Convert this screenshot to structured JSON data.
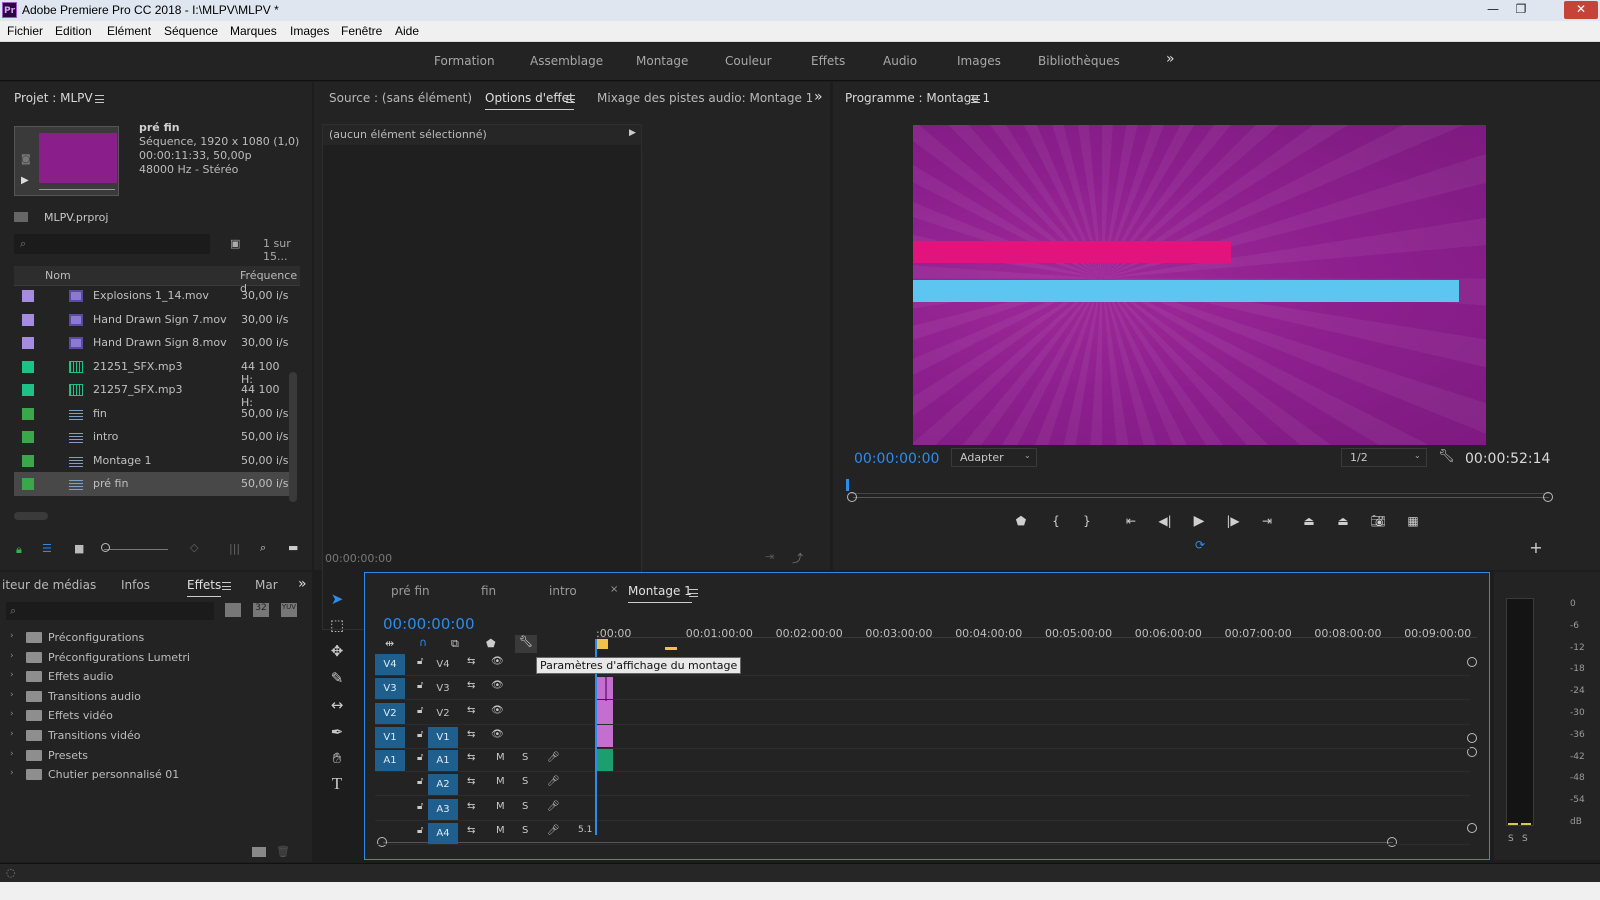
{
  "window": {
    "title": "Adobe Premiere Pro CC 2018 - I:\\MLPV\\MLPV *",
    "app_badge": "Pr"
  },
  "menu": [
    "Fichier",
    "Edition",
    "Elément",
    "Séquence",
    "Marques",
    "Images",
    "Fenêtre",
    "Aide"
  ],
  "workspaces": [
    "Formation",
    "Assemblage",
    "Montage",
    "Couleur",
    "Effets",
    "Audio",
    "Images",
    "Bibliothèques"
  ],
  "project": {
    "tab": "Projet : MLPV",
    "clip_name": "pré fin",
    "clip_info1": "Séquence, 1920 x 1080 (1,0)",
    "clip_info2": "00:00:11:33, 50,00p",
    "clip_info3": "48000 Hz - Stéréo",
    "file": "MLPV.prproj",
    "count": "1 sur 15...",
    "col_name": "Nom",
    "col_rate": "Fréquence d",
    "items": [
      {
        "name": "Explosions 1_14.mov",
        "rate": "30,00 i/s",
        "color": "#a78be0",
        "type": "video"
      },
      {
        "name": "Hand Drawn Sign 7.mov",
        "rate": "30,00 i/s",
        "color": "#a78be0",
        "type": "video"
      },
      {
        "name": "Hand Drawn Sign 8.mov",
        "rate": "30,00 i/s",
        "color": "#a78be0",
        "type": "video"
      },
      {
        "name": "21251_SFX.mp3",
        "rate": "44 100  H:",
        "color": "#1fc286",
        "type": "audio"
      },
      {
        "name": "21257_SFX.mp3",
        "rate": "44 100  H:",
        "color": "#1fc286",
        "type": "audio"
      },
      {
        "name": "fin",
        "rate": "50,00 i/s",
        "color": "#3aa84a",
        "type": "sequence"
      },
      {
        "name": "intro",
        "rate": "50,00 i/s",
        "color": "#3aa84a",
        "type": "sequence"
      },
      {
        "name": "Montage 1",
        "rate": "50,00 i/s",
        "color": "#3aa84a",
        "type": "sequence"
      },
      {
        "name": "pré fin",
        "rate": "50,00 i/s",
        "color": "#3aa84a",
        "type": "sequence"
      }
    ]
  },
  "source_panel": {
    "tabs": [
      "Source : (sans élément)",
      "Options d'effet",
      "Mixage des pistes audio: Montage 1"
    ],
    "active": "Options d'effet",
    "empty_label": "(aucun élément sélectionné)",
    "timecode": "00:00:00:00"
  },
  "program": {
    "tab": "Programme : Montage 1",
    "timecode": "00:00:00:00",
    "fit": "Adapter",
    "resolution": "1/2",
    "duration": "00:00:52:14",
    "colors": {
      "bg": "#8c1f8d",
      "pink": "#e3137e",
      "blue": "#5cc5f0",
      "accent": "#2d8ceb"
    }
  },
  "effects_panel": {
    "tabs": [
      "iteur de médias",
      "Infos",
      "Effets",
      "Mar"
    ],
    "active": "Effets",
    "tree": [
      "Préconfigurations",
      "Préconfigurations Lumetri",
      "Effets audio",
      "Transitions audio",
      "Effets vidéo",
      "Transitions vidéo",
      "Presets",
      "Chutier personnalisé 01"
    ]
  },
  "timeline": {
    "tabs": [
      "pré fin",
      "fin",
      "intro",
      "Montage 1"
    ],
    "active": "Montage 1",
    "timecode": "00:00:00:00",
    "tooltip": "Paramètres d'affichage du montage",
    "ruler": [
      ":00:00",
      "00:01:00:00",
      "00:02:00:00",
      "00:03:00:00",
      "00:04:00:00",
      "00:05:00:00",
      "00:06:00:00",
      "00:07:00:00",
      "00:08:00:00",
      "00:09:00:00"
    ],
    "video_tracks": [
      {
        "target": "V4",
        "name": "V4"
      },
      {
        "target": "V3",
        "name": "V3"
      },
      {
        "target": "V2",
        "name": "V2"
      },
      {
        "target": "V1",
        "name": "V1"
      }
    ],
    "audio_tracks": [
      {
        "target": "A1",
        "name": "A1",
        "label_m": "M",
        "label_s": "S"
      },
      {
        "target": "",
        "name": "A2",
        "label_m": "M",
        "label_s": "S"
      },
      {
        "target": "",
        "name": "A3",
        "label_m": "M",
        "label_s": "S"
      },
      {
        "target": "",
        "name": "A4",
        "label_m": "M",
        "label_s": "S"
      }
    ],
    "audio_value": "5.1"
  },
  "meter": {
    "scale": [
      "0",
      "-6",
      "-12",
      "-18",
      "-24",
      "-30",
      "-36",
      "-42",
      "-48",
      "-54",
      "dB"
    ],
    "solo": [
      "S",
      "S"
    ]
  }
}
